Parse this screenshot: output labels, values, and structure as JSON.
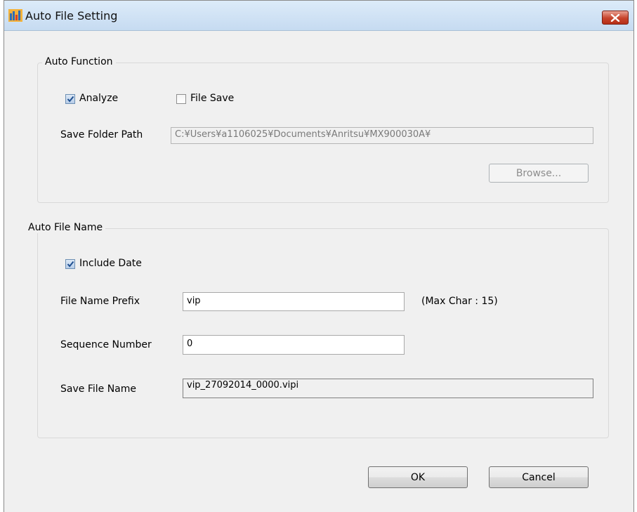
{
  "window": {
    "title": "Auto File Setting",
    "icon": "app-icon",
    "close_icon": "close-icon"
  },
  "auto_function": {
    "group_title": "Auto Function",
    "analyze": {
      "label": "Analyze",
      "checked": true
    },
    "file_save": {
      "label": "File Save",
      "checked": false
    },
    "save_folder_path_label": "Save Folder Path",
    "save_folder_path_value": "C:¥Users¥a1106025¥Documents¥Anritsu¥MX900030A¥",
    "browse_label": "Browse..."
  },
  "auto_file_name": {
    "group_title": "Auto File Name",
    "include_date": {
      "label": "Include Date",
      "checked": true
    },
    "prefix_label": "File Name Prefix",
    "prefix_value": "vip",
    "max_char_note": "(Max Char : 15)",
    "sequence_label": "Sequence Number",
    "sequence_value": "0",
    "save_file_name_label": "Save File Name",
    "save_file_name_value": "vip_27092014_0000.vipi"
  },
  "buttons": {
    "ok_label": "OK",
    "cancel_label": "Cancel"
  },
  "colors": {
    "titlebar": "#c6dbf1",
    "close_button": "#c7432b",
    "dialog_background": "#f0f0f0",
    "checkmark": "#1f4f8f"
  }
}
